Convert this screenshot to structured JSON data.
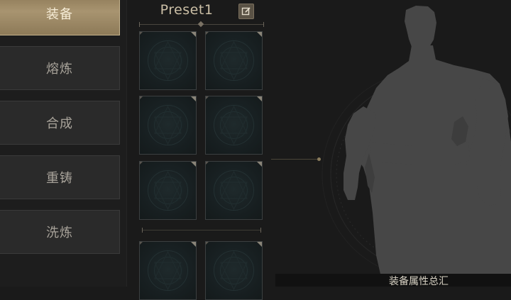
{
  "nav": {
    "items": [
      {
        "label": "装备",
        "active": true
      },
      {
        "label": "熔炼",
        "active": false
      },
      {
        "label": "合成",
        "active": false
      },
      {
        "label": "重铸",
        "active": false
      },
      {
        "label": "洗炼",
        "active": false
      }
    ]
  },
  "preset": {
    "title": "Preset1",
    "edit_icon": "edit-icon"
  },
  "slots": {
    "count": 8
  },
  "character": {
    "silhouette_icon": "character-silhouette"
  },
  "summary": {
    "label": "装备属性总汇"
  },
  "colors": {
    "accent_gold": "#a89470",
    "background": "#1a1a1a",
    "silhouette": "#474747"
  }
}
